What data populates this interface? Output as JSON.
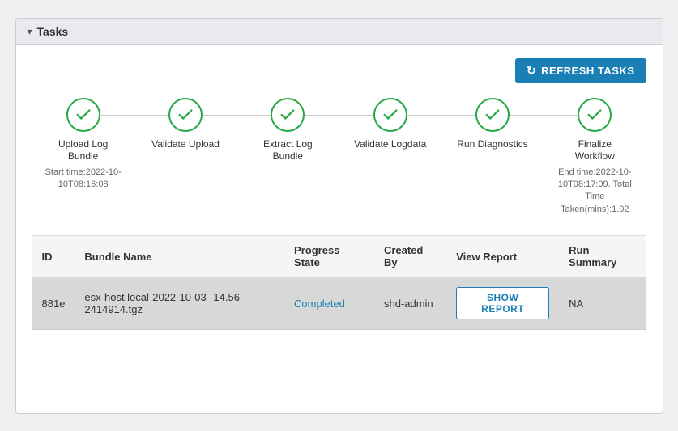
{
  "card": {
    "title": "Tasks",
    "collapse_label": "▾"
  },
  "toolbar": {
    "refresh_label": "REFRESH TASKS",
    "refresh_icon": "↻"
  },
  "workflow": {
    "steps": [
      {
        "id": "upload-log-bundle",
        "label": "Upload Log\nBundle",
        "subtext": "Start time:2022-10-10T08:16:08",
        "completed": true
      },
      {
        "id": "validate-upload",
        "label": "Validate Upload",
        "subtext": "",
        "completed": true
      },
      {
        "id": "extract-log-bundle",
        "label": "Extract Log\nBundle",
        "subtext": "",
        "completed": true
      },
      {
        "id": "validate-logdata",
        "label": "Validate\nLogdata",
        "subtext": "",
        "completed": true
      },
      {
        "id": "run-diagnostics",
        "label": "Run Diagnostics",
        "subtext": "",
        "completed": true
      },
      {
        "id": "finalize-workflow",
        "label": "Finalize\nWorkflow",
        "subtext": "End time:2022-10-10T08:17:09. Total Time Taken(mins):1.02",
        "completed": true
      }
    ]
  },
  "table": {
    "columns": [
      {
        "key": "id",
        "label": "ID"
      },
      {
        "key": "bundle_name",
        "label": "Bundle Name"
      },
      {
        "key": "progress_state",
        "label": "Progress State"
      },
      {
        "key": "created_by",
        "label": "Created By"
      },
      {
        "key": "view_report",
        "label": "View Report"
      },
      {
        "key": "run_summary",
        "label": "Run Summary"
      }
    ],
    "rows": [
      {
        "id": "881e",
        "bundle_name": "esx-host.local-2022-10-03--14.56-2414914.tgz",
        "progress_state": "Completed",
        "created_by": "shd-admin",
        "view_report_btn": "SHOW REPORT",
        "run_summary": "NA"
      }
    ]
  }
}
